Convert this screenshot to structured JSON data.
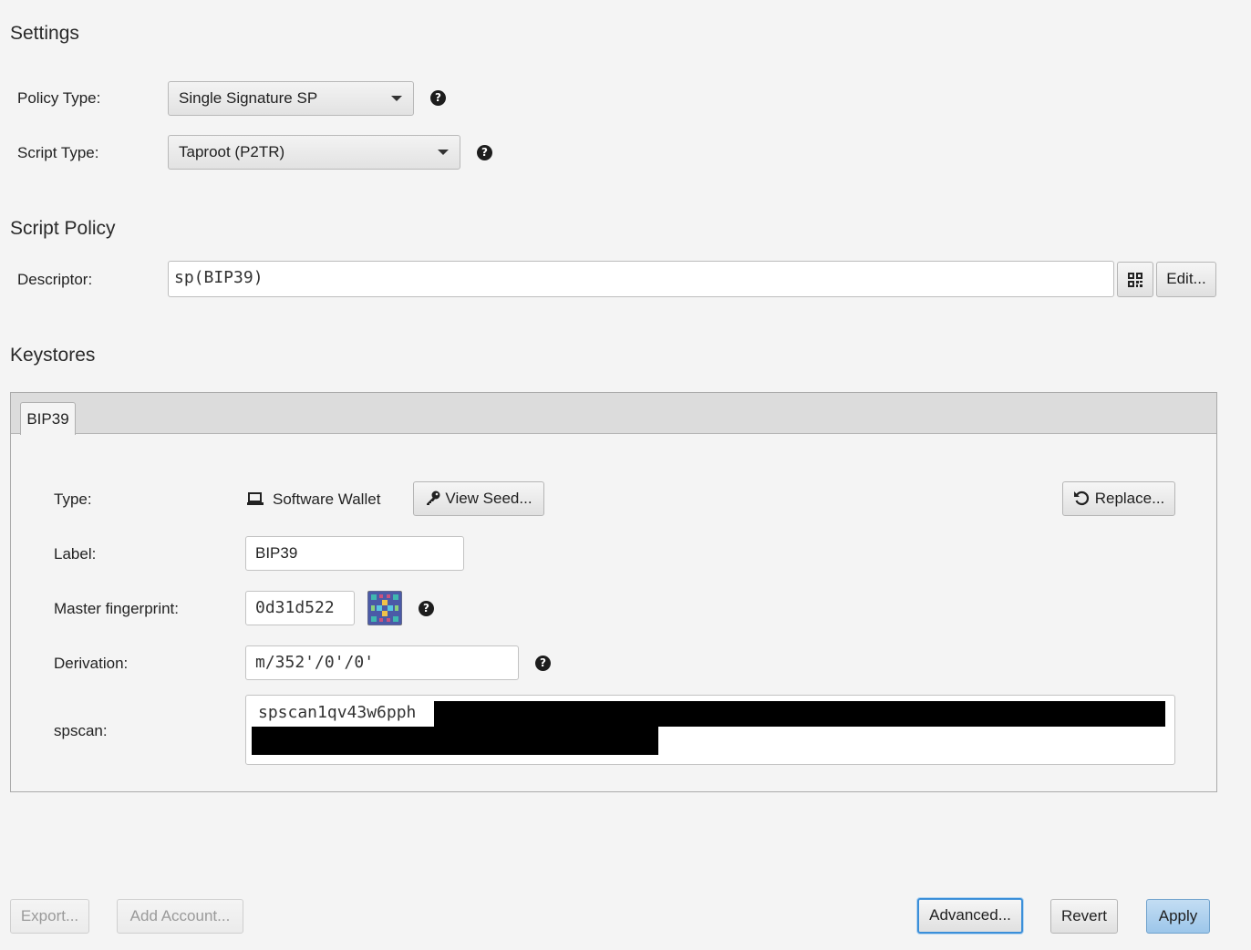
{
  "settings": {
    "title": "Settings",
    "policy_type": {
      "label": "Policy Type:",
      "value": "Single Signature SP"
    },
    "script_type": {
      "label": "Script Type:",
      "value": "Taproot (P2TR)"
    }
  },
  "script_policy": {
    "title": "Script Policy",
    "descriptor": {
      "label": "Descriptor:",
      "value": "sp(BIP39)"
    },
    "edit_label": "Edit..."
  },
  "keystores": {
    "title": "Keystores",
    "tab_label": "BIP39",
    "type": {
      "label": "Type:",
      "value": "Software Wallet",
      "view_seed_label": "View Seed...",
      "replace_label": "Replace..."
    },
    "label_field": {
      "label": "Label:",
      "value": "BIP39"
    },
    "fingerprint": {
      "label": "Master fingerprint:",
      "value": "0d31d522"
    },
    "derivation": {
      "label": "Derivation:",
      "value": "m/352'/0'/0'"
    },
    "spscan": {
      "label": "spscan:",
      "value_visible": "spscan1qv43w6pph"
    }
  },
  "footer": {
    "export_label": "Export...",
    "add_account_label": "Add Account...",
    "advanced_label": "Advanced...",
    "revert_label": "Revert",
    "apply_label": "Apply"
  },
  "colors": {
    "background": "#f4f4f4",
    "focus_border": "#3b8fd9",
    "apply_button": "#aed1ef"
  },
  "icons": [
    "help-icon",
    "qr-code-icon",
    "laptop-icon",
    "key-icon",
    "undo-icon",
    "fingerprint-identicon"
  ]
}
